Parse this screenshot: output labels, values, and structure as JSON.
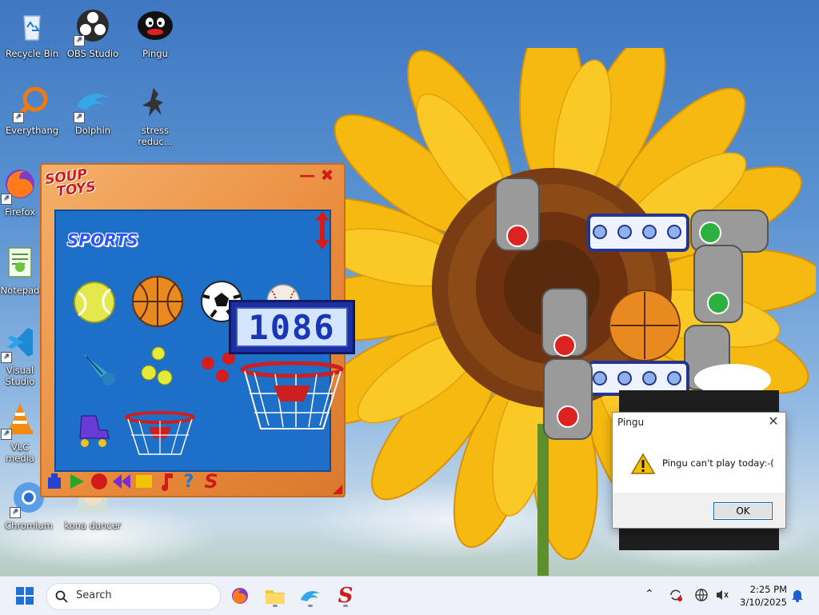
{
  "desktop": {
    "icons": [
      {
        "label": "Recycle Bin",
        "icon": "recycle-bin-icon"
      },
      {
        "label": "OBS Studio",
        "icon": "obs-icon"
      },
      {
        "label": "Pingu",
        "icon": "pingu-icon"
      },
      {
        "label": "Everythang",
        "icon": "everything-search-icon"
      },
      {
        "label": "Dolphin",
        "icon": "dolphin-icon"
      },
      {
        "label": "stress reduc...",
        "icon": "stress-reducer-icon"
      },
      {
        "label": "Firefox",
        "icon": "firefox-icon"
      },
      {
        "label": "Notepad",
        "icon": "notepad-icon"
      },
      {
        "label": "Visual Studio Code",
        "icon": "vscode-icon"
      },
      {
        "label": "VLC media player",
        "icon": "vlc-icon"
      },
      {
        "label": "Chromium",
        "icon": "chromium-icon"
      },
      {
        "label": "kona dancer",
        "icon": "kona-dancer-icon"
      }
    ]
  },
  "soup_toys": {
    "logo_line1": "SOUP",
    "logo_line2": "TOYS",
    "category": "SPORTS",
    "score": "1086",
    "toolbar": [
      "stack-tool",
      "play",
      "record",
      "rewind",
      "stop",
      "music",
      "help",
      "soup-logo"
    ]
  },
  "dialog": {
    "title": "Pingu",
    "message": "Pingu can't play today:-(",
    "ok_label": "OK"
  },
  "taskbar": {
    "search_placeholder": "Search",
    "time": "2:25 PM",
    "date": "3/10/2025"
  },
  "colors": {
    "accent": "#1a64c7",
    "soup_orange": "#e8893a",
    "panel_blue": "#1e6fc8"
  }
}
